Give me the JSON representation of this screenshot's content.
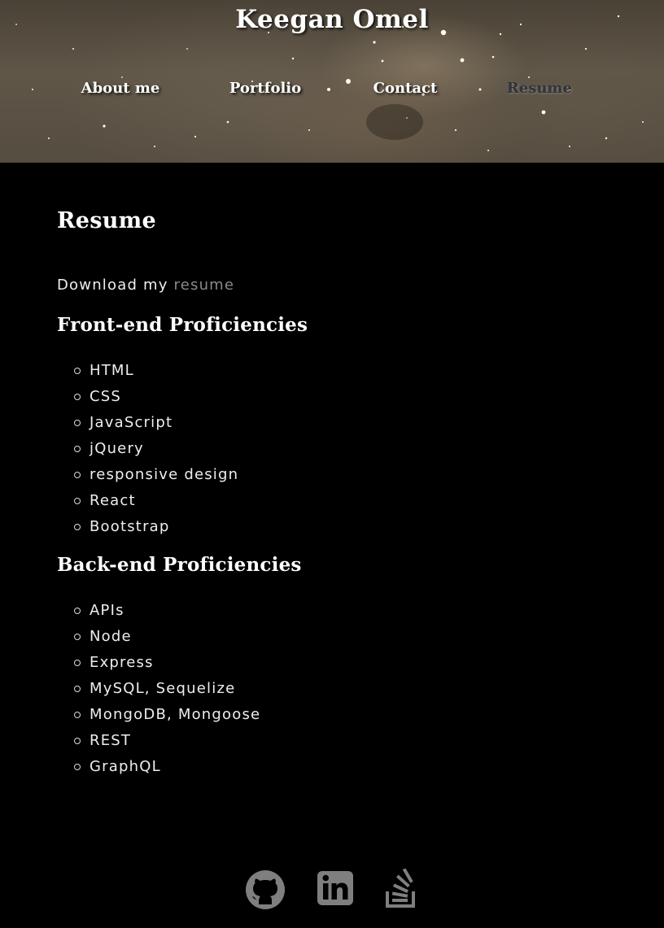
{
  "header": {
    "title": "Keegan Omel",
    "nav": [
      {
        "label": "About me"
      },
      {
        "label": "Portfolio"
      },
      {
        "label": "Contact"
      },
      {
        "label": "Resume",
        "active": true
      }
    ]
  },
  "main": {
    "heading": "Resume",
    "download_prefix": "Download my",
    "download_link": "resume",
    "frontend": {
      "heading": "Front-end Proficiencies",
      "items": [
        "HTML",
        "CSS",
        "JavaScript",
        "jQuery",
        "responsive design",
        "React",
        "Bootstrap"
      ]
    },
    "backend": {
      "heading": "Back-end Proficiencies",
      "items": [
        "APIs",
        "Node",
        "Express",
        "MySQL, Sequelize",
        "MongoDB, Mongoose",
        "REST",
        "GraphQL"
      ]
    }
  },
  "footer": {
    "icons": [
      "github-icon",
      "linkedin-icon",
      "stack-overflow-icon"
    ],
    "icon_color": "#7f7f7f"
  },
  "colors": {
    "background": "#000000",
    "text": "#eeeeee",
    "link_muted": "#8a8a8a",
    "nav_active": "#2f343c"
  }
}
